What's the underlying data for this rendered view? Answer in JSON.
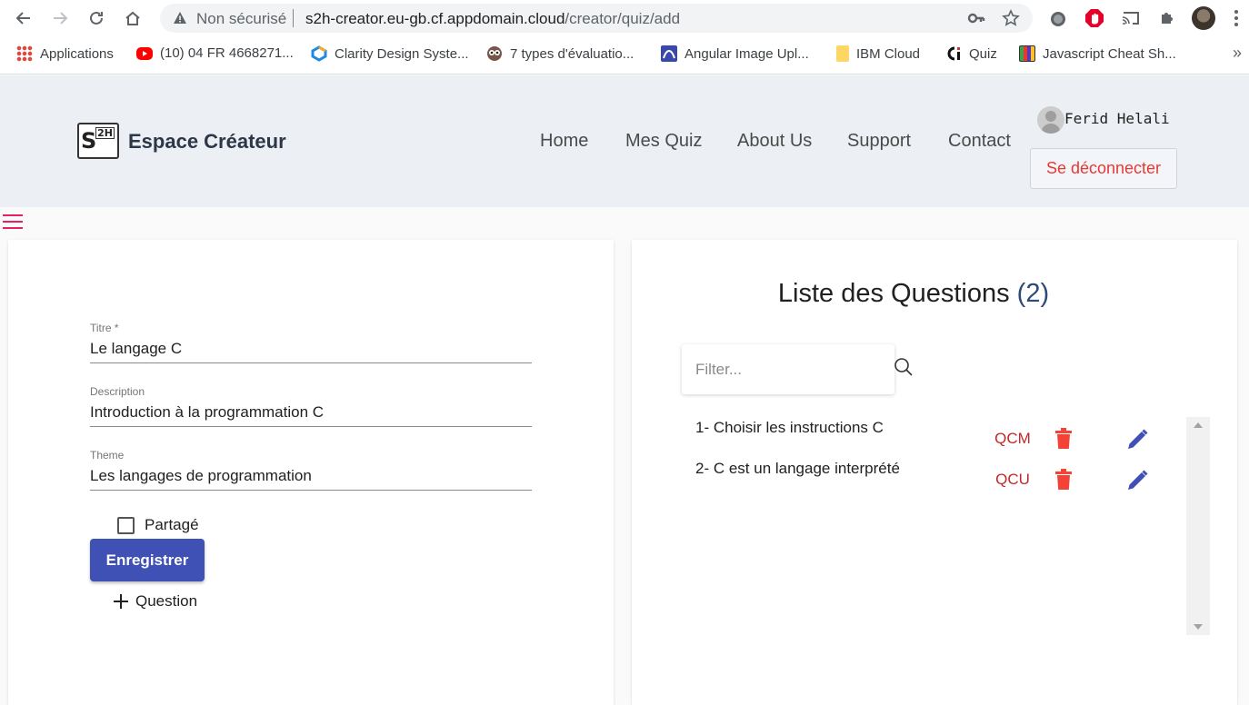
{
  "browser": {
    "insecure_label": "Non sécurisé",
    "url_host": "s2h-creator.eu-gb.cf.appdomain.cloud",
    "url_path": "/creator/quiz/add",
    "bookmarks": [
      {
        "label": "Applications",
        "icon": "apps-grid-icon",
        "color": "#ea4335"
      },
      {
        "label": "(10) 04 FR 4668271...",
        "icon": "youtube-icon",
        "color": "#ff0000"
      },
      {
        "label": "Clarity Design Syste...",
        "icon": "clarity-icon",
        "color": "#1e88e5"
      },
      {
        "label": "7 types d'évaluatio...",
        "icon": "owl-icon",
        "color": "#795548"
      },
      {
        "label": "Angular Image Upl...",
        "icon": "chart-icon",
        "color": "#3949ab"
      },
      {
        "label": "IBM Cloud",
        "icon": "folder-icon",
        "color": "#fdd663"
      },
      {
        "label": "Quiz",
        "icon": "quiz-icon",
        "color": "#d32f2f"
      },
      {
        "label": "Javascript Cheat Sh...",
        "icon": "stripes-icon",
        "color": "#43a047"
      }
    ],
    "more": "»"
  },
  "header": {
    "logo_main": "S",
    "logo_sub": "2H",
    "brand": "Espace Créateur",
    "nav": [
      "Home",
      "Mes Quiz",
      "About Us",
      "Support",
      "Contact"
    ],
    "user_name": "Ferid Helali",
    "logout_label": "Se déconnecter"
  },
  "form": {
    "fields": [
      {
        "label": "Titre *",
        "value": "Le langage C"
      },
      {
        "label": "Description",
        "value": "Introduction à la programmation C"
      },
      {
        "label": "Theme",
        "value": "Les langages de programmation"
      }
    ],
    "shared_label": "Partagé",
    "shared_checked": false,
    "save_label": "Enregistrer",
    "add_question_label": "Question"
  },
  "questions": {
    "title": "Liste des Questions",
    "count": "(2)",
    "filter_placeholder": "Filter...",
    "items": [
      {
        "text": "1- Choisir les instructions C",
        "type": "QCM"
      },
      {
        "text": "2- C est un langage interprété",
        "type": "QCU"
      }
    ]
  },
  "colors": {
    "primary": "#3f51b5",
    "danger": "#e53935",
    "accent": "#e91e63",
    "type_text": "#c62828"
  }
}
